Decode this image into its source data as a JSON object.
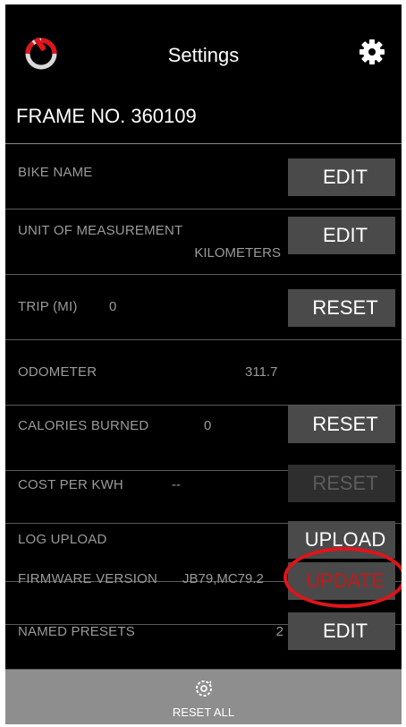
{
  "header": {
    "title": "Settings",
    "power_icon": "power-icon",
    "settings_icon": "gear-icon"
  },
  "frame": {
    "text": "FRAME NO. 360109"
  },
  "rows": [
    {
      "label": "BIKE NAME",
      "value": "",
      "button": "EDIT",
      "button_state": "enabled"
    },
    {
      "label": "UNIT OF MEASUREMENT",
      "value": "KILOMETERS",
      "button": "EDIT",
      "button_state": "enabled"
    },
    {
      "label": "TRIP (MI)",
      "value": "0",
      "button": "RESET",
      "button_state": "enabled"
    },
    {
      "label": "ODOMETER",
      "value": "311.7",
      "button": "",
      "button_state": "none"
    },
    {
      "label": "CALORIES BURNED",
      "value": "0",
      "button": "RESET",
      "button_state": "enabled"
    },
    {
      "label": "COST PER KWH",
      "value": "--",
      "button": "RESET",
      "button_state": "disabled"
    },
    {
      "label": "LOG UPLOAD",
      "value": "",
      "button": "UPLOAD",
      "button_state": "enabled"
    },
    {
      "label": "FIRMWARE VERSION",
      "value": "JB79,MC79.2",
      "button": "UPDATE",
      "button_state": "highlighted"
    },
    {
      "label": "NAMED PRESETS",
      "value": "2",
      "button": "EDIT",
      "button_state": "enabled"
    }
  ],
  "footer": {
    "reset_all_label": "RESET ALL",
    "reset_icon": "reset-gear-icon"
  },
  "colors": {
    "background": "#000000",
    "accent_red": "#e0141a",
    "button_bg": "#4a4a4a",
    "footer_bg": "#8e8e8e",
    "label_gray": "#9a9a9a"
  }
}
